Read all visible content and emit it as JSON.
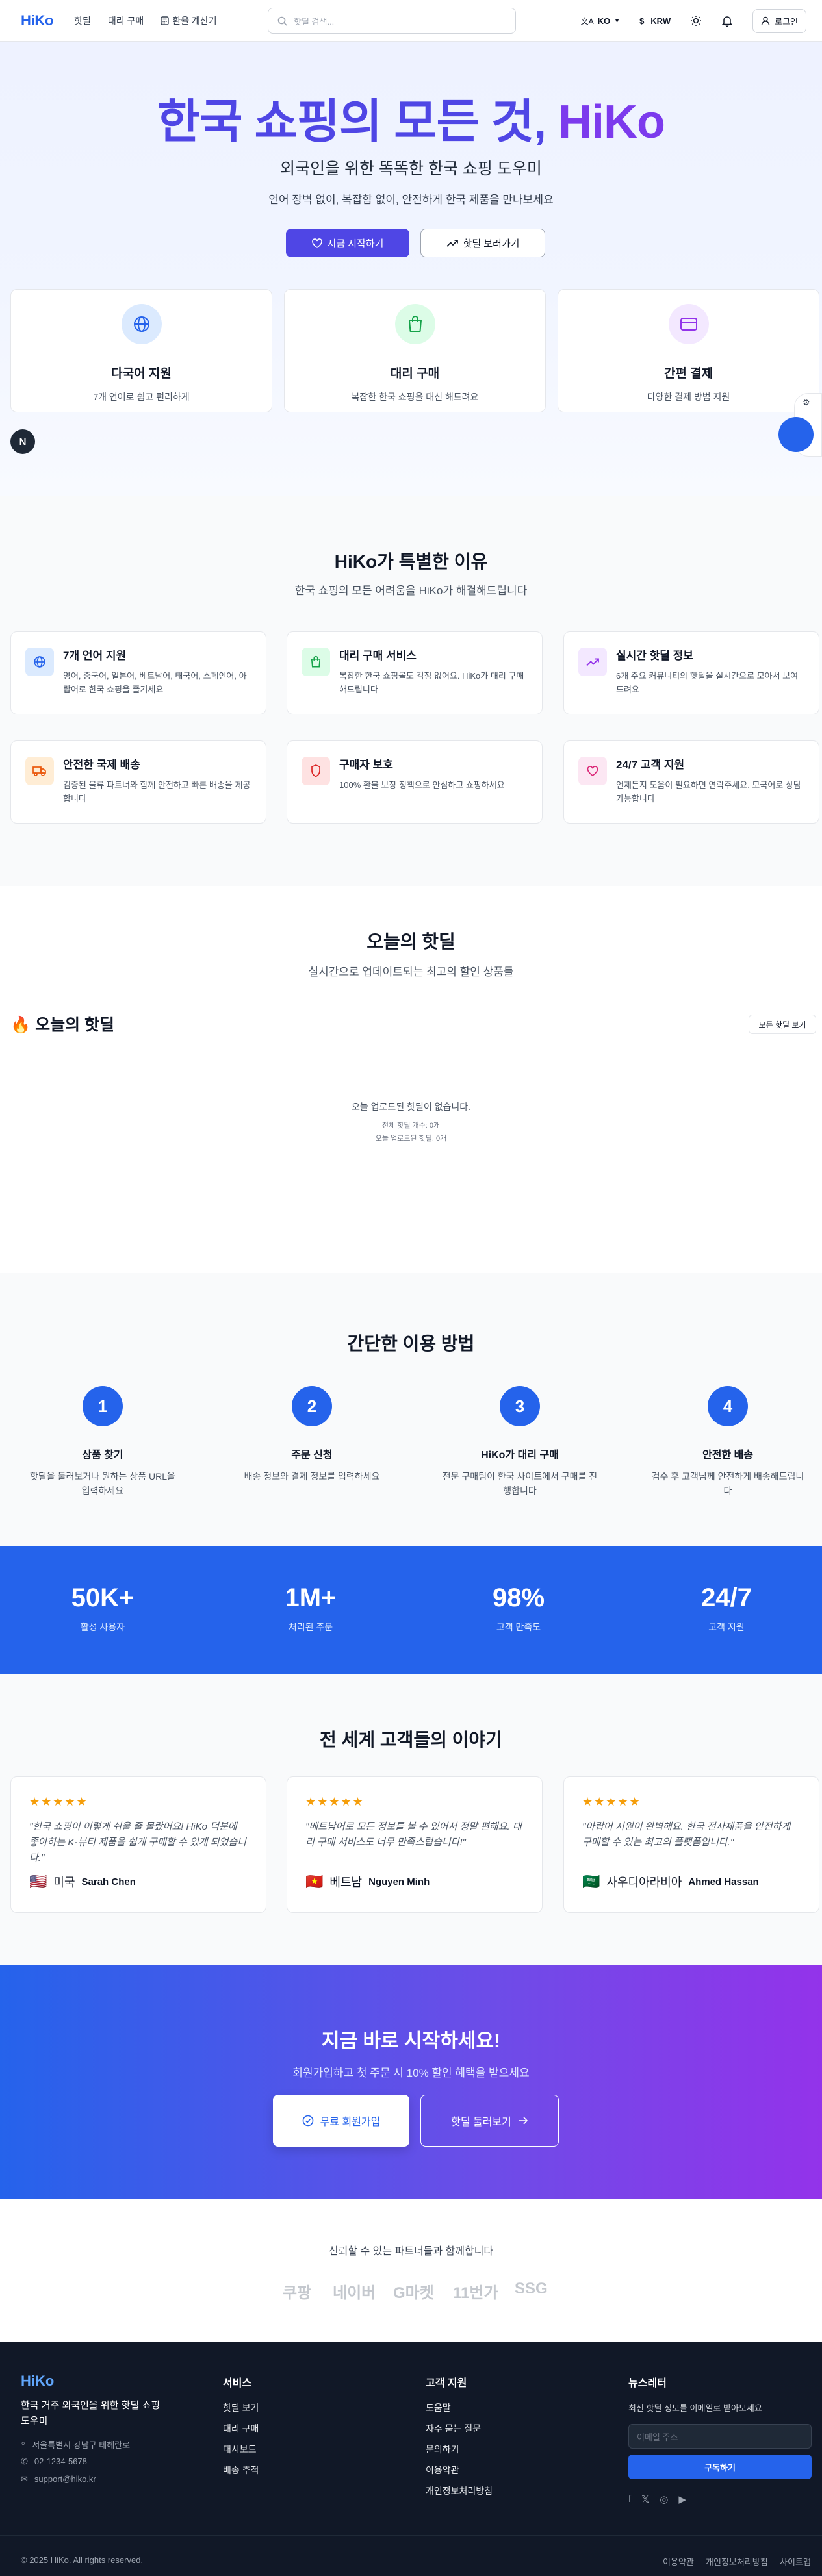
{
  "colors": {
    "brand_blue": "#2563eb",
    "brand_purple": "#7c3aed",
    "indigo": "#4f46e5",
    "stats_bg": "#2563eb",
    "footer_bg": "#111827",
    "star": "#f59e0b"
  },
  "header": {
    "logo": "HiKo",
    "nav": [
      {
        "label": "핫딜",
        "icon": "none"
      },
      {
        "label": "대리 구매",
        "icon": "none"
      },
      {
        "label": "환율 계산기",
        "icon": "calculator-icon"
      }
    ],
    "search_placeholder": "핫딜 검색...",
    "language": "KO",
    "currency_symbol": "$",
    "currency": "KRW",
    "login": "로그인"
  },
  "hero": {
    "title_main": "한국 쇼핑의 모든 것, ",
    "title_brand": "HiKo",
    "subtitle": "외국인을 위한 똑똑한 한국 쇼핑 도우미",
    "desc": "언어 장벽 없이, 복잡함 없이, 안전하게 한국 제품을 만나보세요",
    "primary_cta": "지금 시작하기",
    "secondary_cta": "핫딜 보러가기",
    "features": [
      {
        "title": "다국어 지원",
        "desc": "7개 언어로 쉽고 편리하게",
        "icon": "globe-icon",
        "color": "#dbeafe",
        "fg": "#2563eb"
      },
      {
        "title": "대리 구매",
        "desc": "복잡한 한국 쇼핑을 대신 해드려요",
        "icon": "shopping-bag-icon",
        "color": "#dcfce7",
        "fg": "#16a34a"
      },
      {
        "title": "간편 결제",
        "desc": "다양한 결제 방법 지원",
        "icon": "credit-card-icon",
        "color": "#f3e8ff",
        "fg": "#9333ea"
      }
    ]
  },
  "why": {
    "title": "HiKo가 특별한 이유",
    "subtitle": "한국 쇼핑의 모든 어려움을 HiKo가 해결해드립니다",
    "items": [
      {
        "title": "7개 언어 지원",
        "desc": "영어, 중국어, 일본어, 베트남어, 태국어, 스페인어, 아랍어로 한국 쇼핑을 즐기세요",
        "icon": "globe-icon",
        "color": "#dbeafe",
        "fg": "#2563eb"
      },
      {
        "title": "대리 구매 서비스",
        "desc": "복잡한 한국 쇼핑몰도 걱정 없어요. HiKo가 대리 구매해드립니다",
        "icon": "shopping-bag-icon",
        "color": "#dcfce7",
        "fg": "#16a34a"
      },
      {
        "title": "실시간 핫딜 정보",
        "desc": "6개 주요 커뮤니티의 핫딜을 실시간으로 모아서 보여드려요",
        "icon": "trending-up-icon",
        "color": "#f3e8ff",
        "fg": "#9333ea"
      },
      {
        "title": "안전한 국제 배송",
        "desc": "검증된 물류 파트너와 함께 안전하고 빠른 배송을 제공합니다",
        "icon": "truck-icon",
        "color": "#ffedd5",
        "fg": "#ea580c"
      },
      {
        "title": "구매자 보호",
        "desc": "100% 환불 보장 정책으로 안심하고 쇼핑하세요",
        "icon": "shield-icon",
        "color": "#fee2e2",
        "fg": "#dc2626"
      },
      {
        "title": "24/7 고객 지원",
        "desc": "언제든지 도움이 필요하면 연락주세요. 모국어로 상담 가능합니다",
        "icon": "heart-icon",
        "color": "#fce7f3",
        "fg": "#db2777"
      }
    ]
  },
  "deals": {
    "title": "오늘의 핫딜",
    "subtitle": "실시간으로 업데이트되는 최고의 할인 상품들",
    "list_title": "🔥 오늘의 핫딜",
    "view_all": "모든 핫딜 보기",
    "empty": "오늘 업로드된 핫딜이 없습니다.",
    "total": "전체 핫딜 개수: 0개",
    "today": "오늘 업로드된 핫딜: 0개"
  },
  "steps": {
    "title": "간단한 이용 방법",
    "items": [
      {
        "num": "1",
        "title": "상품 찾기",
        "desc": "핫딜을 둘러보거나 원하는 상품 URL을 입력하세요"
      },
      {
        "num": "2",
        "title": "주문 신청",
        "desc": "배송 정보와 결제 정보를 입력하세요"
      },
      {
        "num": "3",
        "title": "HiKo가 대리 구매",
        "desc": "전문 구매팀이 한국 사이트에서 구매를 진행합니다"
      },
      {
        "num": "4",
        "title": "안전한 배송",
        "desc": "검수 후 고객님께 안전하게 배송해드립니다"
      }
    ]
  },
  "stats": [
    {
      "value": "50K+",
      "label": "활성 사용자"
    },
    {
      "value": "1M+",
      "label": "처리된 주문"
    },
    {
      "value": "98%",
      "label": "고객 만족도"
    },
    {
      "value": "24/7",
      "label": "고객 지원"
    }
  ],
  "testimonials": {
    "title": "전 세계 고객들의 이야기",
    "items": [
      {
        "stars": "★★★★★",
        "quote": "\"한국 쇼핑이 이렇게 쉬울 줄 몰랐어요! HiKo 덕분에 좋아하는 K-뷰티 제품을 쉽게 구매할 수 있게 되었습니다.\"",
        "flag": "🇺🇸",
        "country": "미국",
        "name": "Sarah Chen"
      },
      {
        "stars": "★★★★★",
        "quote": "\"베트남어로 모든 정보를 볼 수 있어서 정말 편해요. 대리 구매 서비스도 너무 만족스럽습니다!\"",
        "flag": "🇻🇳",
        "country": "베트남",
        "name": "Nguyen Minh"
      },
      {
        "stars": "★★★★★",
        "quote": "\"아랍어 지원이 완벽해요. 한국 전자제품을 안전하게 구매할 수 있는 최고의 플랫폼입니다.\"",
        "flag": "🇸🇦",
        "country": "사우디아라비아",
        "name": "Ahmed Hassan"
      }
    ]
  },
  "cta": {
    "title": "지금 바로 시작하세요!",
    "subtitle": "회원가입하고 첫 주문 시 10% 할인 혜택을 받으세요",
    "primary": "무료 회원가입",
    "secondary": "핫딜 둘러보기"
  },
  "partners": {
    "title": "신뢰할 수 있는 파트너들과 함께합니다",
    "items": [
      "쿠팡",
      "네이버",
      "G마켓",
      "11번가",
      "SSG"
    ]
  },
  "footer": {
    "logo": "HiKo",
    "tagline": "한국 거주 외국인을 위한 핫딜 쇼핑 도우미",
    "address": "서울특별시 강남구 테헤란로",
    "phone": "02-1234-5678",
    "email": "support@hiko.kr",
    "services_title": "서비스",
    "services": [
      "핫딜 보기",
      "대리 구매",
      "대시보드",
      "배송 추적"
    ],
    "support_title": "고객 지원",
    "support": [
      "도움말",
      "자주 묻는 질문",
      "문의하기",
      "이용약관",
      "개인정보처리방침"
    ],
    "newsletter_title": "뉴스레터",
    "newsletter_desc": "최신 핫딜 정보를 이메일로 받아보세요",
    "newsletter_placeholder": "이메일 주소",
    "newsletter_button": "구독하기",
    "copyright": "© 2025 HiKo. All rights reserved.",
    "bottom_links": [
      "이용약관",
      "개인정보처리방침",
      "사이트맵"
    ]
  }
}
